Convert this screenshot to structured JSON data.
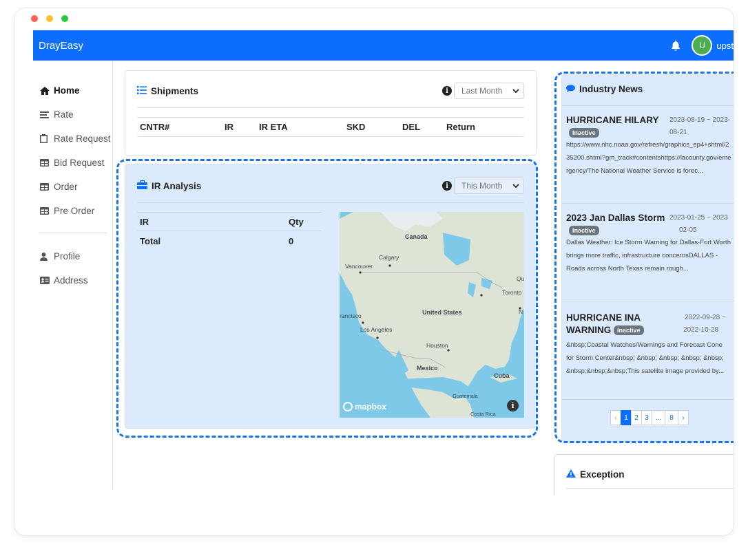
{
  "app": {
    "brand": "DrayEasy",
    "user_initial": "U",
    "user_name": "upst"
  },
  "sidebar": {
    "items": [
      {
        "label": "Home",
        "icon": "home-icon"
      },
      {
        "label": "Rate",
        "icon": "rate-icon"
      },
      {
        "label": "Rate Request",
        "icon": "clipboard-icon"
      },
      {
        "label": "Bid Request",
        "icon": "table-icon"
      },
      {
        "label": "Order",
        "icon": "table-icon"
      },
      {
        "label": "Pre Order",
        "icon": "table-icon"
      }
    ],
    "secondary": [
      {
        "label": "Profile",
        "icon": "user-icon"
      },
      {
        "label": "Address",
        "icon": "address-card-icon"
      }
    ]
  },
  "shipments": {
    "title": "Shipments",
    "filter": "Last Month",
    "columns": [
      "CNTR#",
      "IR",
      "IR ETA",
      "SKD",
      "DEL",
      "Return"
    ]
  },
  "ir_analysis": {
    "title": "IR Analysis",
    "filter": "This Month",
    "columns": [
      "IR",
      "Qty"
    ],
    "rows": [
      {
        "label": "Total",
        "qty": "0"
      }
    ]
  },
  "map": {
    "labels": {
      "canada": "Canada",
      "calgary": "Calgary",
      "vancouver": "Vancouver",
      "qu": "Qu",
      "toronto": "Toronto",
      "n": "N",
      "united_states": "United States",
      "francisco": "rancisco",
      "los_angeles": "Los Angeles",
      "houston": "Houston",
      "mexico": "Mexico",
      "cuba": "Cuba",
      "guatemala": "Guatemala",
      "costa_rica": "Costa Rica"
    },
    "attribution": "mapbox"
  },
  "news": {
    "title": "Industry News",
    "items": [
      {
        "title": "HURRICANE HILARY",
        "date_start": "2023-08-19 ~ 2023-",
        "date_end": "08-21",
        "status": "Inactive",
        "body": "https://www.nhc.noaa.gov/refresh/graphics_ep4+shtml/235200.shtml?gm_track#contentshttps://lacounty.gov/emergency/The National Weather Service is forec..."
      },
      {
        "title": "2023 Jan Dallas Storm",
        "date_start": "2023-01-25 ~ 2023",
        "date_end": "02-05",
        "status": "Inactive",
        "body": "Dallas Weather: Ice Storm Warning for Dallas-Fort Worth brings more traffic, infrastructure concernsDALLAS - Roads across North Texas remain rough..."
      },
      {
        "title_line1": "HURRICANE INA",
        "title_line2": "WARNING",
        "date_start": "2022-09-28 ~",
        "date_end": "2022-10-28",
        "status": "Inactive",
        "body": "&nbsp;Coastal Watches/Warnings and Forecast Cone for Storm Center&nbsp; &nbsp; &nbsp; &nbsp; &nbsp; &nbsp;&nbsp;&nbsp;This satellite image provided by..."
      }
    ],
    "pagination": [
      "‹",
      "1",
      "2",
      "3",
      "...",
      "8",
      "›"
    ],
    "current_page": "1"
  },
  "exception": {
    "title": "Exception"
  },
  "colors": {
    "primary": "#0d6efd",
    "highlight": "#dbeafc",
    "dashed_outline": "#1a73e8",
    "badge_inactive": "#6c757d",
    "avatar": "#4caf50",
    "window_dots": [
      "#ff5f57",
      "#febc2e",
      "#28c840"
    ]
  }
}
